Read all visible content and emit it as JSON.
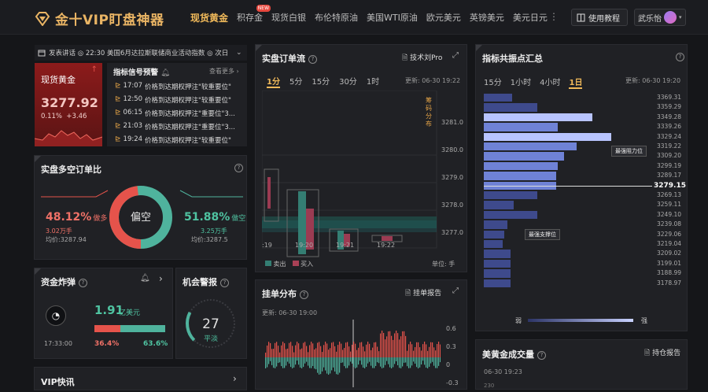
{
  "app": {
    "title": "金十VIP盯盘神器"
  },
  "nav": {
    "items": [
      "现货黄金",
      "积存金",
      "现货白银",
      "布伦特原油",
      "美国WTI原油",
      "欧元美元",
      "英镑美元",
      "美元日元"
    ],
    "new_badge": "NEW",
    "more": "⋮"
  },
  "header": {
    "tutorial": "使用教程",
    "user": "武乐怡"
  },
  "ticker": {
    "text": "发表讲话 ◎ 22:30 美国6月达拉斯联储商业活动指数 ◎ 次日"
  },
  "gold": {
    "name": "现货黄金",
    "price": "3277.92",
    "change_pct": "0.11%",
    "change": "+3.46"
  },
  "signals": {
    "title": "指标信号预警",
    "more": "查看更多",
    "items": [
      {
        "time": "17:07",
        "text": "价格到达期权押注\"较重要位\""
      },
      {
        "time": "12:50",
        "text": "价格到达期权押注\"较重要位\""
      },
      {
        "time": "06:15",
        "text": "价格到达期权押注\"重要位\"3..."
      },
      {
        "time": "21:03",
        "text": "价格到达期权押注\"重要位\"3..."
      },
      {
        "time": "19:24",
        "text": "价格到达期权押注\"较重要位\""
      }
    ]
  },
  "ls": {
    "title": "实盘多空订单比",
    "long_pct": "48.12%",
    "long_label": "做多",
    "long_amount": "3.02万手",
    "long_avg_label": "均价:",
    "long_avg": "3287.94",
    "short_pct": "51.88%",
    "short_label": "做空",
    "short_amount": "3.25万手",
    "short_avg_label": "均价:",
    "short_avg": "3287.5",
    "center": "偏空",
    "long_ratio": 0.4812
  },
  "fund": {
    "title": "资金炸弹",
    "amount": "1.91",
    "unit": "亿美元",
    "time": "17:33:00",
    "red_pct": "36.4%",
    "green_pct": "63.6%",
    "red_ratio": 0.364
  },
  "alert": {
    "title": "机会警报",
    "value": "27",
    "label": "平淡",
    "level": 0.27
  },
  "vip": {
    "title": "VIP快讯"
  },
  "flow": {
    "title": "实盘订单流",
    "author": "技术刘Pro",
    "tabs": [
      "1分",
      "5分",
      "15分",
      "30分",
      "1时"
    ],
    "active_tab": "1分",
    "updated": "更新: 06-30 19:22",
    "side_label": "筹码分布",
    "y_ticks": [
      "3281.0",
      "3280.0",
      "3279.0",
      "3278.0",
      "3277.0"
    ],
    "x_ticks": [
      ":19",
      "19:20",
      "19:21",
      "19:22"
    ],
    "legend_sell": "卖出",
    "legend_buy": "买入",
    "unit": "单位: 手"
  },
  "depth": {
    "title": "挂单分布",
    "report": "挂单报告",
    "updated": "更新: 06-30 19:00",
    "y_ticks": [
      "0.6",
      "0.3",
      "0",
      "-0.3"
    ]
  },
  "reso": {
    "title": "指标共振点汇总",
    "tabs": [
      "15分",
      "1小时",
      "4小时",
      "1日"
    ],
    "active_tab": "1日",
    "updated": "更新: 06-30 19:20",
    "levels": [
      "3369.31",
      "3359.29",
      "3349.28",
      "3339.26",
      "3329.24",
      "3319.22",
      "3309.20",
      "3299.19",
      "3289.17",
      "3279.15",
      "3269.13",
      "3259.11",
      "3249.10",
      "3239.08",
      "3229.06",
      "3219.04",
      "3209.02",
      "3199.01",
      "3188.99",
      "3178.97"
    ],
    "values": [
      42,
      80,
      162,
      110,
      190,
      138,
      120,
      110,
      108,
      108,
      80,
      45,
      80,
      35,
      30,
      28,
      40,
      40,
      40,
      40
    ],
    "current": "3279.15",
    "resist": "最强阻力位",
    "support": "最强支撑位",
    "weak": "弱",
    "strong": "强"
  },
  "volume": {
    "title": "美黄金成交量",
    "report": "持仓报告",
    "updated": "06-30 19:23",
    "first_tick": "230"
  },
  "colors": {
    "accent": "#f0b95a",
    "red": "#e5534b",
    "green": "#4fb39d",
    "blue": "#6f82d6"
  }
}
